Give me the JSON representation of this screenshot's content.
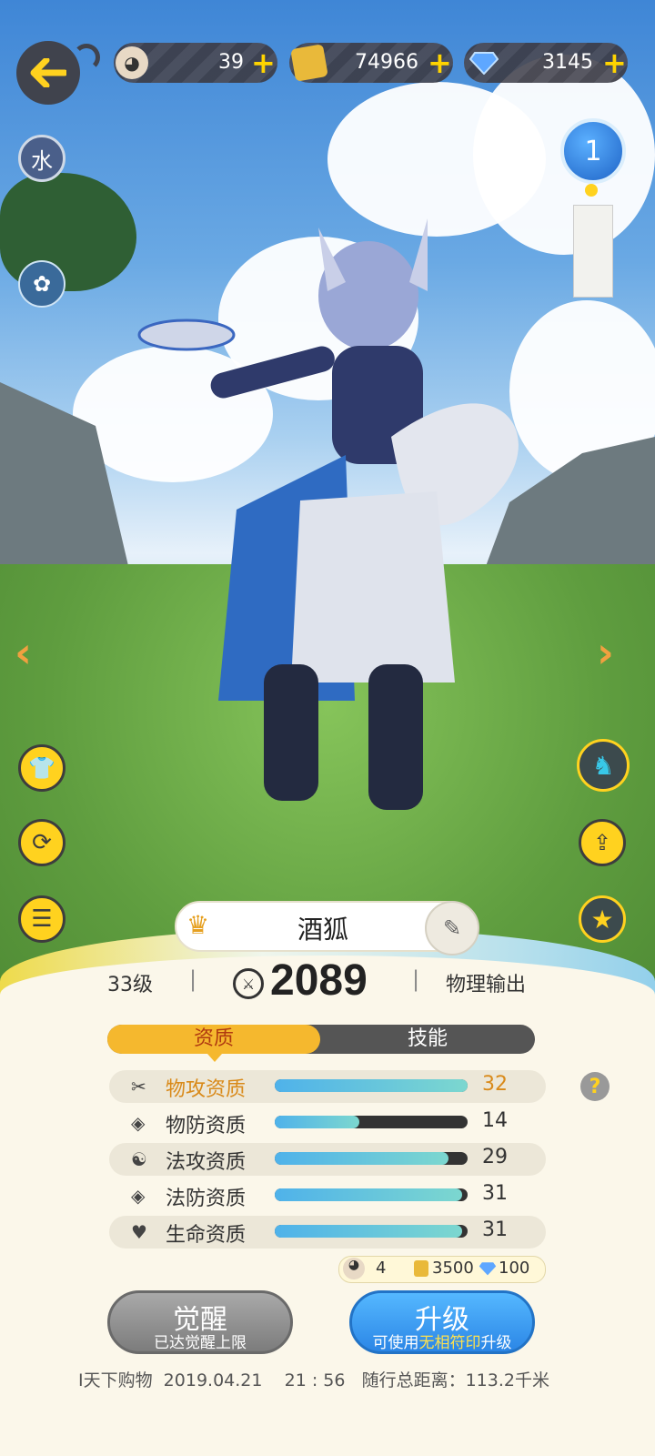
{
  "hud": {
    "item1_value": "39",
    "gold_value": "74966",
    "gem_value": "3145",
    "level_badge": "1",
    "element_tag": "水"
  },
  "character": {
    "name": "酒狐",
    "level": "33级",
    "power": "2089",
    "role": "物理输出"
  },
  "tabs": {
    "aptitude": "资质",
    "skills": "技能"
  },
  "stats": [
    {
      "label": "物攻资质",
      "value": "32",
      "fill": 1.0,
      "highlight": true
    },
    {
      "label": "物防资质",
      "value": "14",
      "fill": 0.44
    },
    {
      "label": "法攻资质",
      "value": "29",
      "fill": 0.9
    },
    {
      "label": "法防资质",
      "value": "31",
      "fill": 0.97
    },
    {
      "label": "生命资质",
      "value": "31",
      "fill": 0.97
    }
  ],
  "cost": {
    "item": "4",
    "gold": "3500",
    "gem": "100"
  },
  "awaken": {
    "title": "觉醒",
    "sub": "已达觉醒上限"
  },
  "upgrade": {
    "title": "升级",
    "sub_pre": "可使用",
    "sub_hl": "无相符印",
    "sub_post": "升级"
  },
  "footer": {
    "text": "I天下购物  2019.04.21    21 : 56   随行总距离：113.2千米"
  },
  "colors": {
    "accent": "#ffd21f",
    "highlight": "#d98a1a",
    "tab_active": "#f5b82e"
  }
}
